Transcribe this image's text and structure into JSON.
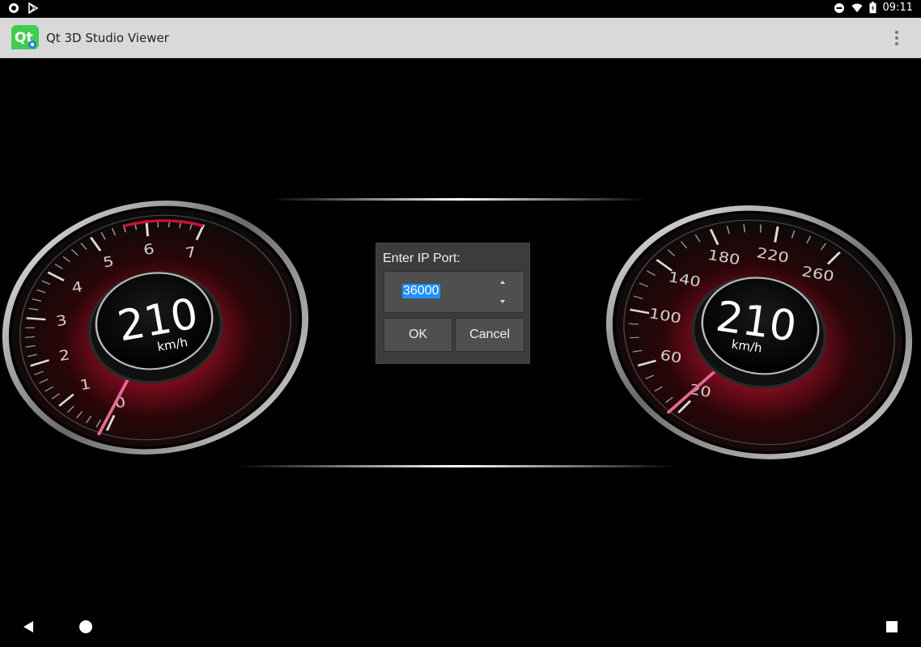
{
  "status_bar": {
    "time": "09:11",
    "icons": [
      "circle-notification-icon",
      "play-store-icon",
      "do-not-disturb-icon",
      "wifi-icon",
      "battery-icon"
    ]
  },
  "app_bar": {
    "logo_text": "Qt",
    "title": "Qt 3D Studio Viewer",
    "menu_icon": "overflow-menu-icon"
  },
  "cluster": {
    "tachometer": {
      "value": "210",
      "unit": "km/h",
      "ticks": [
        "0",
        "1",
        "2",
        "3",
        "4",
        "5",
        "6",
        "7"
      ],
      "needle_value": 0.1,
      "needle_max": 7
    },
    "speedometer": {
      "value": "210",
      "unit": "km/h",
      "ticks": [
        "20",
        "60",
        "100",
        "140",
        "180",
        "220",
        "260"
      ],
      "needle_value": 5,
      "needle_max": 280
    },
    "colors": {
      "accent": "#d01030",
      "needle": "#e56a9a",
      "bezel": "#c8c8c8"
    }
  },
  "dialog": {
    "title": "Enter IP Port:",
    "port_value": "36000",
    "ok_label": "OK",
    "cancel_label": "Cancel"
  },
  "nav_bar": {
    "icons": [
      "back-icon",
      "home-icon",
      "recents-icon"
    ]
  }
}
